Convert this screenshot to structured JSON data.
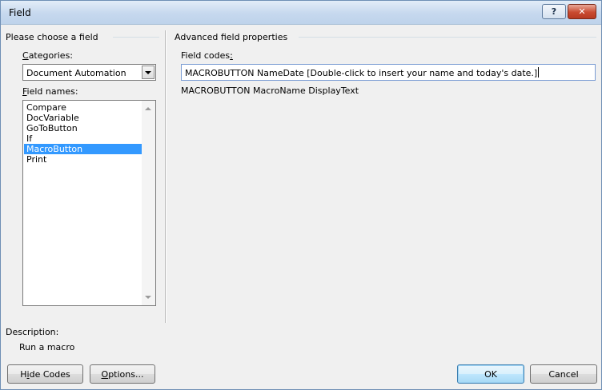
{
  "window": {
    "title": "Field",
    "help_label": "?",
    "close_label": "✕"
  },
  "left": {
    "section_title": "Please choose a field",
    "categories_label": "Categories:",
    "categories_accel": "C",
    "categories_rest": "ategories:",
    "categories_value": "Document Automation",
    "field_names_accel": "F",
    "field_names_rest": "ield names:",
    "field_names": [
      "Compare",
      "DocVariable",
      "GoToButton",
      "If",
      "MacroButton",
      "Print"
    ],
    "selected_index": 4,
    "description_label": "Description:",
    "description_text": "Run a macro"
  },
  "right": {
    "section_title": "Advanced field properties",
    "field_codes_pre": "Field codes",
    "field_codes_accel": ":",
    "field_codes_value": "MACROBUTTON  NameDate [Double-click to insert your name and today's date.]",
    "syntax_hint": "MACROBUTTON MacroName DisplayText"
  },
  "buttons": {
    "hide_codes_accel": "i",
    "hide_codes_pre": "H",
    "hide_codes_post": "de Codes",
    "options_accel": "O",
    "options_post": "ptions...",
    "ok": "OK",
    "cancel": "Cancel"
  }
}
